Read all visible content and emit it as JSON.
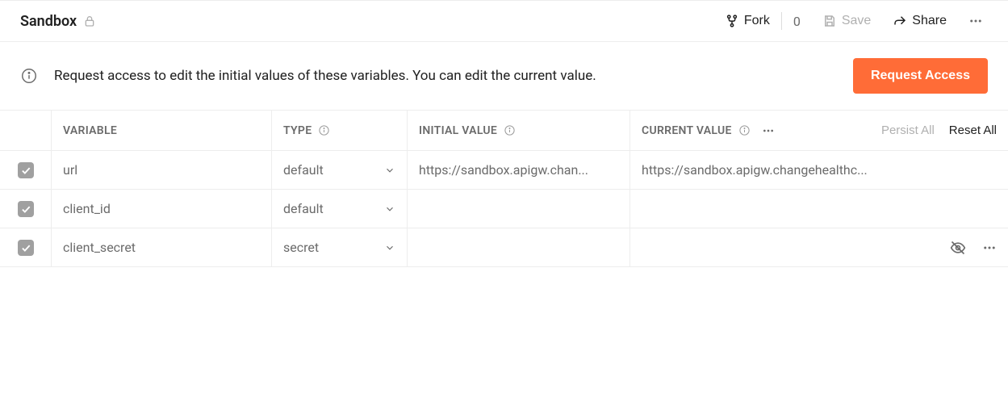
{
  "header": {
    "title": "Sandbox",
    "fork_label": "Fork",
    "fork_count": "0",
    "save_label": "Save",
    "share_label": "Share"
  },
  "banner": {
    "text": "Request access to edit the initial values of these variables. You can edit the current value.",
    "button": "Request Access"
  },
  "table": {
    "headers": {
      "variable": "VARIABLE",
      "type": "TYPE",
      "initial": "INITIAL VALUE",
      "current": "CURRENT VALUE",
      "persist": "Persist All",
      "reset": "Reset All"
    },
    "rows": [
      {
        "variable": "url",
        "type": "default",
        "initial": "https://sandbox.apigw.chan...",
        "current": "https://sandbox.apigw.changehealthc...",
        "secret": false
      },
      {
        "variable": "client_id",
        "type": "default",
        "initial": "",
        "current": "",
        "secret": false
      },
      {
        "variable": "client_secret",
        "type": "secret",
        "initial": "",
        "current": "",
        "secret": true
      }
    ]
  }
}
